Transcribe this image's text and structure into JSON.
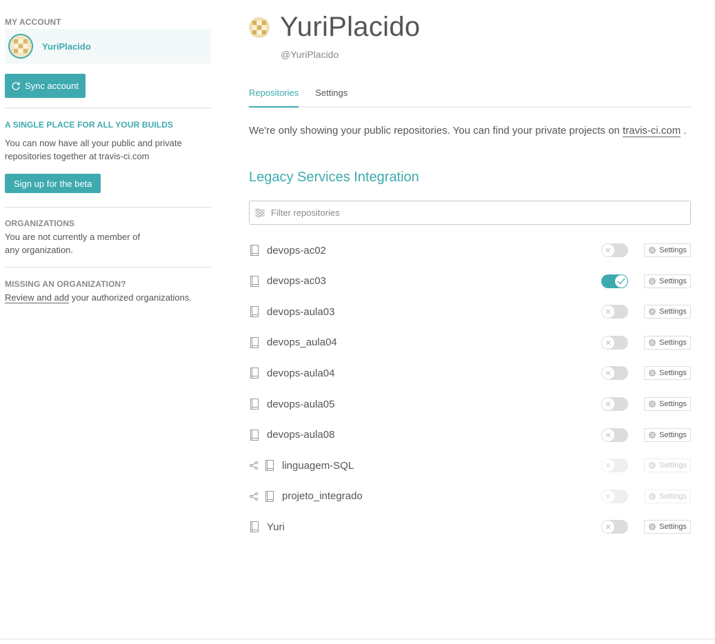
{
  "sidebar": {
    "my_account": "MY ACCOUNT",
    "account_name": "YuriPlacido",
    "sync_label": "Sync account",
    "beta_heading": "A SINGLE PLACE FOR ALL YOUR BUILDS",
    "beta_text_1": "You can now have all your public and private",
    "beta_text_2": "repositories together at travis-ci.com",
    "beta_button": "Sign up for the beta",
    "orgs_heading": "ORGANIZATIONS",
    "orgs_text_1": "You are not currently a member of",
    "orgs_text_2": "any organization.",
    "missing_heading": "MISSING AN ORGANIZATION?",
    "missing_link": "Review and add",
    "missing_text": " your authorized organizations."
  },
  "profile": {
    "name": "YuriPlacido",
    "handle": "@YuriPlacido"
  },
  "tabs": {
    "repositories": "Repositories",
    "settings": "Settings"
  },
  "notice": {
    "text": "We're only showing your public repositories. You can find your private projects on ",
    "link": "travis-ci.com",
    "end": " ."
  },
  "section_title": "Legacy Services Integration",
  "filter": {
    "placeholder": "Filter repositories"
  },
  "settings_label": "Settings",
  "repos": [
    {
      "name": "devops-ac02",
      "enabled": false,
      "forked": false,
      "disabled": false
    },
    {
      "name": "devops-ac03",
      "enabled": true,
      "forked": false,
      "disabled": false
    },
    {
      "name": "devops-aula03",
      "enabled": false,
      "forked": false,
      "disabled": false
    },
    {
      "name": "devops_aula04",
      "enabled": false,
      "forked": false,
      "disabled": false
    },
    {
      "name": "devops-aula04",
      "enabled": false,
      "forked": false,
      "disabled": false
    },
    {
      "name": "devops-aula05",
      "enabled": false,
      "forked": false,
      "disabled": false
    },
    {
      "name": "devops-aula08",
      "enabled": false,
      "forked": false,
      "disabled": false
    },
    {
      "name": "linguagem-SQL",
      "enabled": false,
      "forked": true,
      "disabled": true
    },
    {
      "name": "projeto_integrado",
      "enabled": false,
      "forked": true,
      "disabled": true
    },
    {
      "name": "Yuri",
      "enabled": false,
      "forked": false,
      "disabled": false
    }
  ],
  "colors": {
    "accent": "#3eaaaf",
    "text": "#555555",
    "muted": "#8a8a8a"
  },
  "icons": {
    "sync": "sync-icon",
    "filter": "filter-icon",
    "repo": "book-icon",
    "fork": "fork-icon",
    "gear": "gear-icon",
    "check": "check-icon",
    "x": "x-icon"
  }
}
